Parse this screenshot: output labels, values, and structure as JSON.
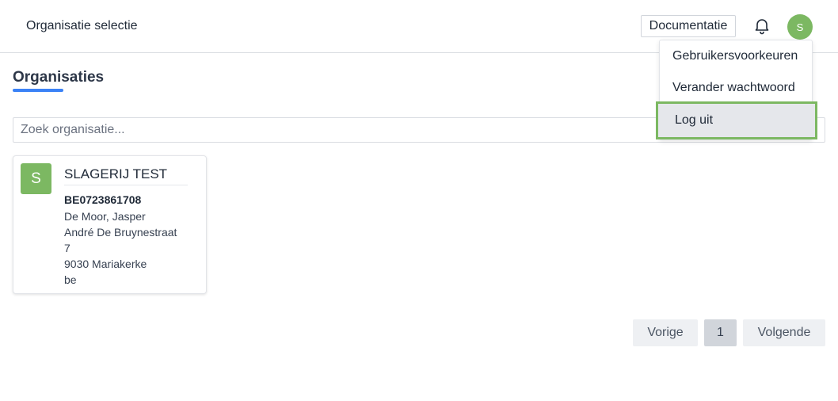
{
  "header": {
    "title": "Organisatie selectie",
    "documentation_label": "Documentatie",
    "notifications_icon": "bell-icon",
    "user_initial": "S"
  },
  "user_menu": {
    "items": [
      {
        "label": "Gebruikersvoorkeuren"
      },
      {
        "label": "Verander wachtwoord"
      },
      {
        "label": "Log uit",
        "highlighted": true
      }
    ]
  },
  "main": {
    "title": "Organisaties",
    "search_placeholder": "Zoek organisatie...",
    "organisations": [
      {
        "initial": "S",
        "name": "SLAGERIJ TEST",
        "vat": "BE0723861708",
        "contact": "De Moor, Jasper",
        "street": "André De Bruynestraat",
        "number": "7",
        "city": "9030 Mariakerke",
        "country": "be"
      }
    ]
  },
  "pagination": {
    "prev_label": "Vorige",
    "current_page": "1",
    "next_label": "Volgende"
  },
  "colors": {
    "accent": "#3b82f6",
    "avatar_green": "#7cb862",
    "highlight_border": "#7cb862"
  }
}
